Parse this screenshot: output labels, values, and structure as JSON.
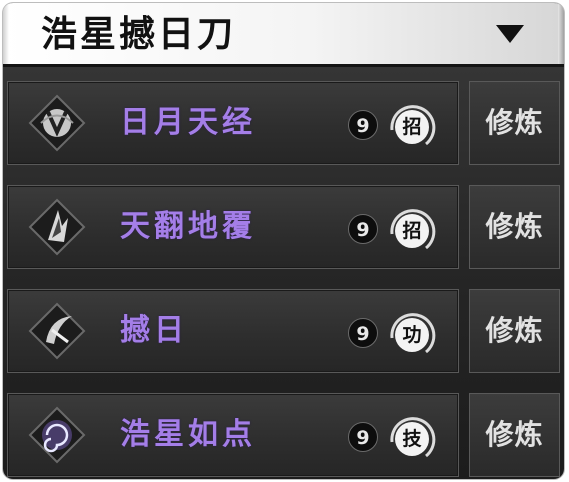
{
  "header": {
    "title": "浩星撼日刀"
  },
  "skills": [
    {
      "name": "日月天经",
      "level": "9",
      "type": "招",
      "train_label": "修炼",
      "icon": "sword-crest-icon"
    },
    {
      "name": "天翻地覆",
      "level": "9",
      "type": "招",
      "train_label": "修炼",
      "icon": "flame-blade-icon"
    },
    {
      "name": "撼日",
      "level": "9",
      "type": "功",
      "train_label": "修炼",
      "icon": "crescent-slash-icon"
    },
    {
      "name": "浩星如点",
      "level": "9",
      "type": "技",
      "train_label": "修炼",
      "icon": "swirl-star-icon"
    }
  ],
  "colors": {
    "skill_name": "#a47ee8",
    "panel_bg": "#2a2a2a",
    "header_bg": "#f4f4f4"
  }
}
